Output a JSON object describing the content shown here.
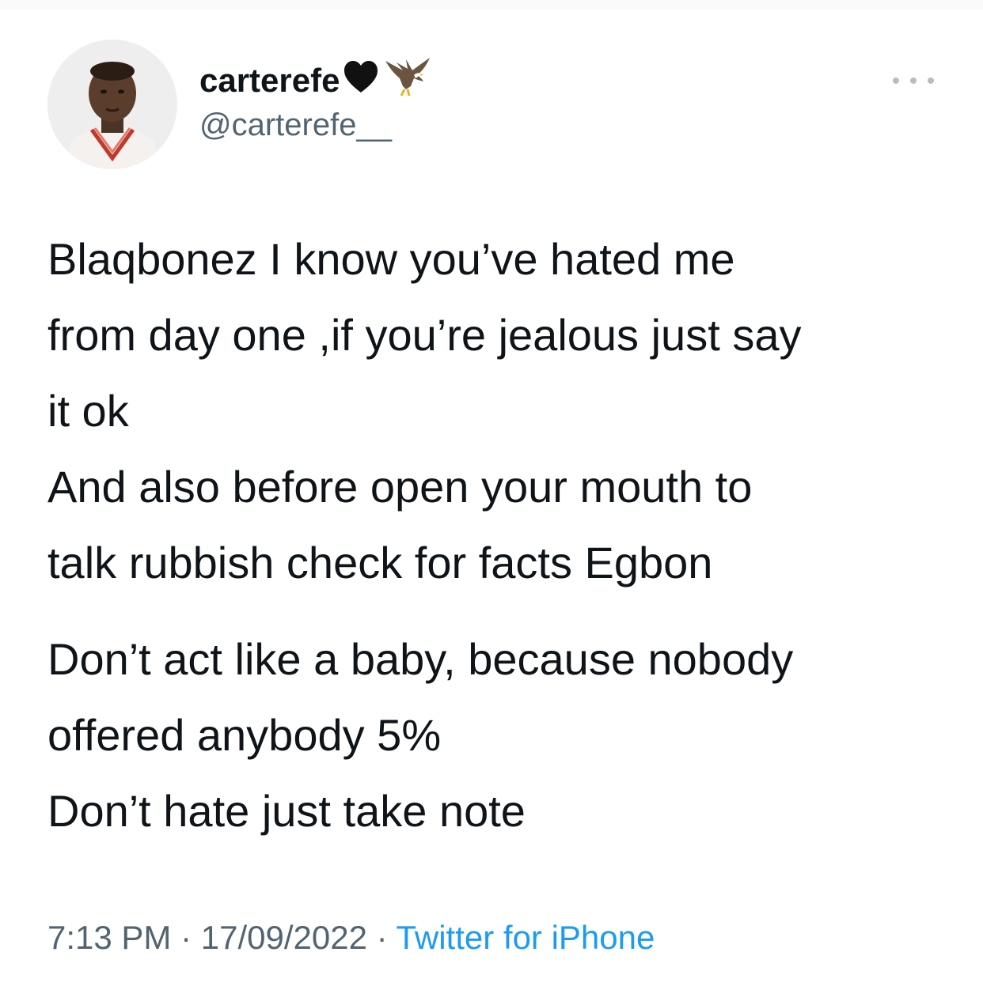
{
  "author": {
    "display_name": "carterefe",
    "handle": "@carterefe__",
    "avatar_icon": "profile-photo-icon",
    "name_emojis": [
      "black-heart-icon",
      "eagle-icon"
    ]
  },
  "more_icon": "ellipsis-icon",
  "tweet": {
    "lines_p1": [
      "Blaqbonez I know you’ve hated me",
      "from day one ,if you’re jealous just say",
      "it ok",
      "And also before open your mouth to",
      "talk rubbish check for facts Egbon"
    ],
    "lines_p2": [
      "Don’t act like a baby, because nobody",
      "offered anybody 5%",
      "Don’t hate just take note"
    ]
  },
  "meta": {
    "time": "7:13 PM",
    "sep1": " · ",
    "date": "17/09/2022",
    "sep2": " · ",
    "source": "Twitter for iPhone"
  },
  "colors": {
    "text": "#0f1419",
    "secondary": "#536471",
    "link": "#1d9bf0"
  }
}
